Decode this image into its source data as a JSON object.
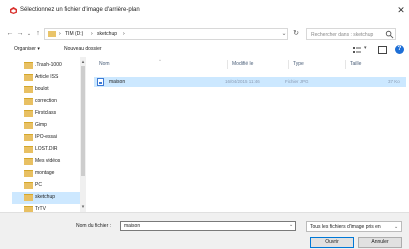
{
  "window": {
    "title": "Sélectionnez un fichier d'image d'arrière-plan",
    "close_glyph": "✕"
  },
  "address": {
    "crumbs": [
      "TIM (D:)",
      "sketchup"
    ],
    "separators": [
      "›",
      "›",
      "›"
    ],
    "search_placeholder": "Rechercher dans : sketchup"
  },
  "toolbar": {
    "organize": "Organiser ▾",
    "new_folder": "Nouveau dossier"
  },
  "nav": {
    "items": [
      {
        "label": ".Trash-1000",
        "selected": false
      },
      {
        "label": "Article ISS",
        "selected": false
      },
      {
        "label": "boulot",
        "selected": false
      },
      {
        "label": "correction",
        "selected": false
      },
      {
        "label": "Firstclass",
        "selected": false
      },
      {
        "label": "Gimp",
        "selected": false
      },
      {
        "label": "IPO-essai",
        "selected": false
      },
      {
        "label": "LOST.DIR",
        "selected": false
      },
      {
        "label": "Mes vidéos",
        "selected": false
      },
      {
        "label": "montage",
        "selected": false
      },
      {
        "label": "PC",
        "selected": false
      },
      {
        "label": "sketchup",
        "selected": true
      },
      {
        "label": "TrTV",
        "selected": false
      }
    ]
  },
  "columns": {
    "name": "Nom",
    "modified": "Modifié le",
    "type": "Type",
    "size": "Taille"
  },
  "files": [
    {
      "name": "maison",
      "modified": "16/04/2015 11:46",
      "type": "Fichier JPG",
      "size": "37 Ko"
    }
  ],
  "bottom": {
    "filename_label": "Nom du fichier :",
    "filename_value": "maison",
    "filter": "Tous les fichiers d'image pris en",
    "open_button": "Ouvrir",
    "cancel_button": "Annuler"
  },
  "colors": {
    "accent": "#0078d7",
    "selection": "#cce8ff",
    "folder": "#e8c063"
  }
}
